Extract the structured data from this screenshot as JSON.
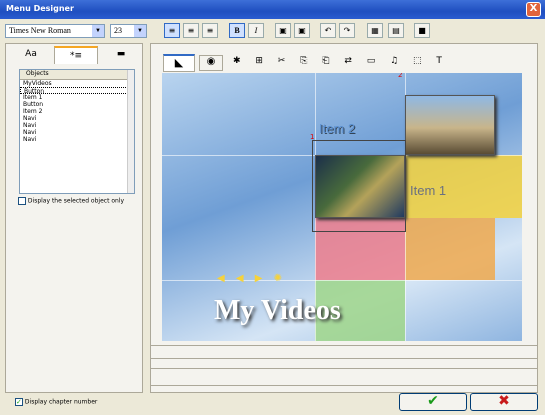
{
  "window": {
    "title": "Menu Designer",
    "close": "X"
  },
  "toolbar": {
    "font": "Times New Roman",
    "size": "23",
    "bold": "B",
    "italic": "I"
  },
  "left": {
    "tab1": "Aa",
    "tab2": "*≡",
    "objects_header": "Objects",
    "objects": [
      "MyVideos",
      "Button",
      "Item 1",
      "Button",
      "Item 2",
      "Navi",
      "Navi",
      "Navi",
      "Navi"
    ],
    "display_selected": "Display the selected object only",
    "display_chapter": "Display chapter number"
  },
  "stage": {
    "title": "My Videos",
    "item1": "Item 1",
    "item2": "Item 2",
    "mark1": "1",
    "mark2": "2"
  },
  "colors": {
    "accent": "#316ac5"
  }
}
